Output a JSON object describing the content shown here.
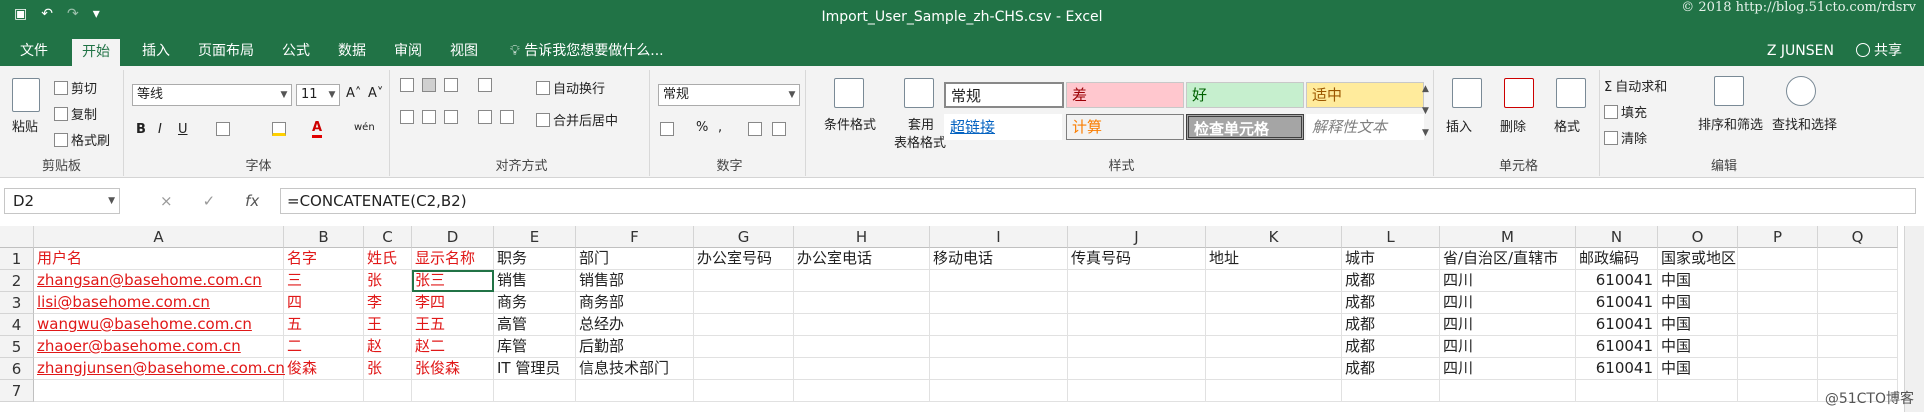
{
  "window": {
    "title": "Import_User_Sample_zh-CHS.csv - Excel",
    "watermark": "© 2018 http://blog.51cto.com/rdsrv",
    "user": "Z JUNSEN",
    "share": "共享"
  },
  "qat": {
    "save_icon": "save-icon",
    "undo_icon": "undo-icon",
    "redo_icon": "redo-icon",
    "more": "▾"
  },
  "tabs": [
    {
      "label": "文件"
    },
    {
      "label": "开始"
    },
    {
      "label": "插入"
    },
    {
      "label": "页面布局"
    },
    {
      "label": "公式"
    },
    {
      "label": "数据"
    },
    {
      "label": "审阅"
    },
    {
      "label": "视图"
    }
  ],
  "tellme": "告诉我您想要做什么...",
  "ribbon": {
    "clipboard": {
      "label": "剪贴板",
      "paste": "粘贴",
      "cut": "剪切",
      "copy": "复制",
      "format_painter": "格式刷"
    },
    "font": {
      "label": "字体",
      "name": "等线",
      "size": "11",
      "bold": "B",
      "italic": "I",
      "underline": "U",
      "grow": "A˄",
      "shrink": "A˅",
      "wen": "wén"
    },
    "alignment": {
      "label": "对齐方式",
      "wrap": "自动换行",
      "merge": "合并后居中"
    },
    "number": {
      "label": "数字",
      "format": "常规",
      "percent": "%",
      "comma": ","
    },
    "styles": {
      "label": "样式",
      "conditional": "条件格式",
      "table1": "套用",
      "table2": "表格格式",
      "cells": [
        "常规",
        "差",
        "好",
        "适中",
        "超链接",
        "计算",
        "检查单元格",
        "解释性文本"
      ]
    },
    "cells": {
      "label": "单元格",
      "insert": "插入",
      "delete": "删除",
      "format": "格式"
    },
    "editing": {
      "label": "编辑",
      "autosum": "自动求和",
      "fill": "填充",
      "clear": "清除",
      "sort": "排序和筛选",
      "find": "查找和选择"
    }
  },
  "formula_bar": {
    "name_box": "D2",
    "cancel": "×",
    "enter": "✓",
    "fx": "fx",
    "formula": "=CONCATENATE(C2,B2)"
  },
  "columns": [
    "A",
    "B",
    "C",
    "D",
    "E",
    "F",
    "G",
    "H",
    "I",
    "J",
    "K",
    "L",
    "M",
    "N",
    "O",
    "P",
    "Q"
  ],
  "rows": [
    "1",
    "2",
    "3",
    "4",
    "5",
    "6",
    "7"
  ],
  "sheet": [
    [
      "用户名",
      "名字",
      "姓氏",
      "显示名称",
      "职务",
      "部门",
      "办公室号码",
      "办公室电话",
      "移动电话",
      "传真号码",
      "地址",
      "城市",
      "省/自治区/直辖市",
      "邮政编码",
      "国家或地区",
      "",
      ""
    ],
    [
      "zhangsan@basehome.com.cn",
      "三",
      "张",
      "张三",
      "销售",
      "销售部",
      "",
      "",
      "",
      "",
      "",
      "成都",
      "四川",
      "610041",
      "中国",
      "",
      ""
    ],
    [
      "lisi@basehome.com.cn",
      "四",
      "李",
      "李四",
      "商务",
      "商务部",
      "",
      "",
      "",
      "",
      "",
      "成都",
      "四川",
      "610041",
      "中国",
      "",
      ""
    ],
    [
      "wangwu@basehome.com.cn",
      "五",
      "王",
      "王五",
      "高管",
      "总经办",
      "",
      "",
      "",
      "",
      "",
      "成都",
      "四川",
      "610041",
      "中国",
      "",
      ""
    ],
    [
      "zhaoer@basehome.com.cn",
      "二",
      "赵",
      "赵二",
      "库管",
      "后勤部",
      "",
      "",
      "",
      "",
      "",
      "成都",
      "四川",
      "610041",
      "中国",
      "",
      ""
    ],
    [
      "zhangjunsen@basehome.com.cn",
      "俊森",
      "张",
      "张俊森",
      "IT 管理员",
      "信息技术部门",
      "",
      "",
      "",
      "",
      "",
      "成都",
      "四川",
      "610041",
      "中国",
      "",
      ""
    ],
    [
      "",
      "",
      "",
      "",
      "",
      "",
      "",
      "",
      "",
      "",
      "",
      "",
      "",
      "",
      "",
      "",
      ""
    ]
  ],
  "credit": "@51CTO博客"
}
